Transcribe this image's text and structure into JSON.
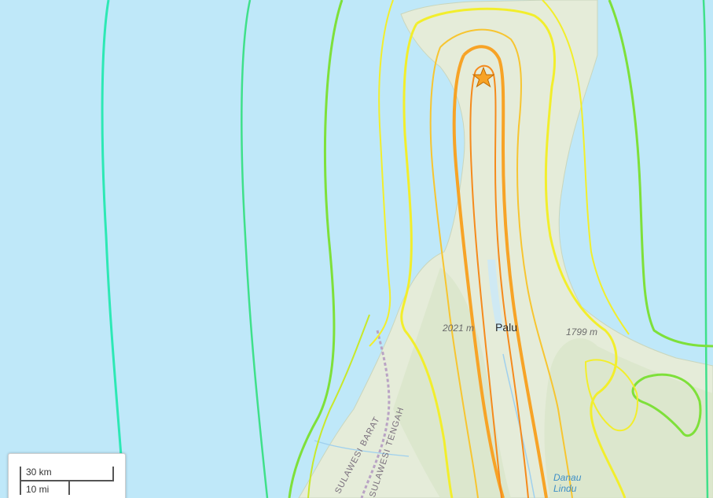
{
  "map": {
    "basemap": "topographic",
    "colors": {
      "water": "#bfe8f9",
      "land": "#e6eddc",
      "contour_far": "#2de8b5",
      "contour_mid": "#3fe08a",
      "contour_green": "#7ee03a",
      "contour_yellowgreen": "#c8e82a",
      "contour_yellow": "#f2ee2c",
      "contour_amber": "#f7c530",
      "contour_orange": "#f7a326",
      "contour_deep_orange": "#f58a1c"
    },
    "markers": {
      "epicenter": {
        "icon": "star-icon",
        "color": "#f7a326"
      }
    },
    "labels": {
      "city": "Palu",
      "elevation_west": "2021 m",
      "elevation_east": "1799 m",
      "lake": "Danau Lindu",
      "province_west": "SULAWESI BARAT",
      "province_central": "SULAWESI TENGAH"
    },
    "scale_bar": {
      "metric": "30 km",
      "imperial": "10 mi"
    }
  }
}
